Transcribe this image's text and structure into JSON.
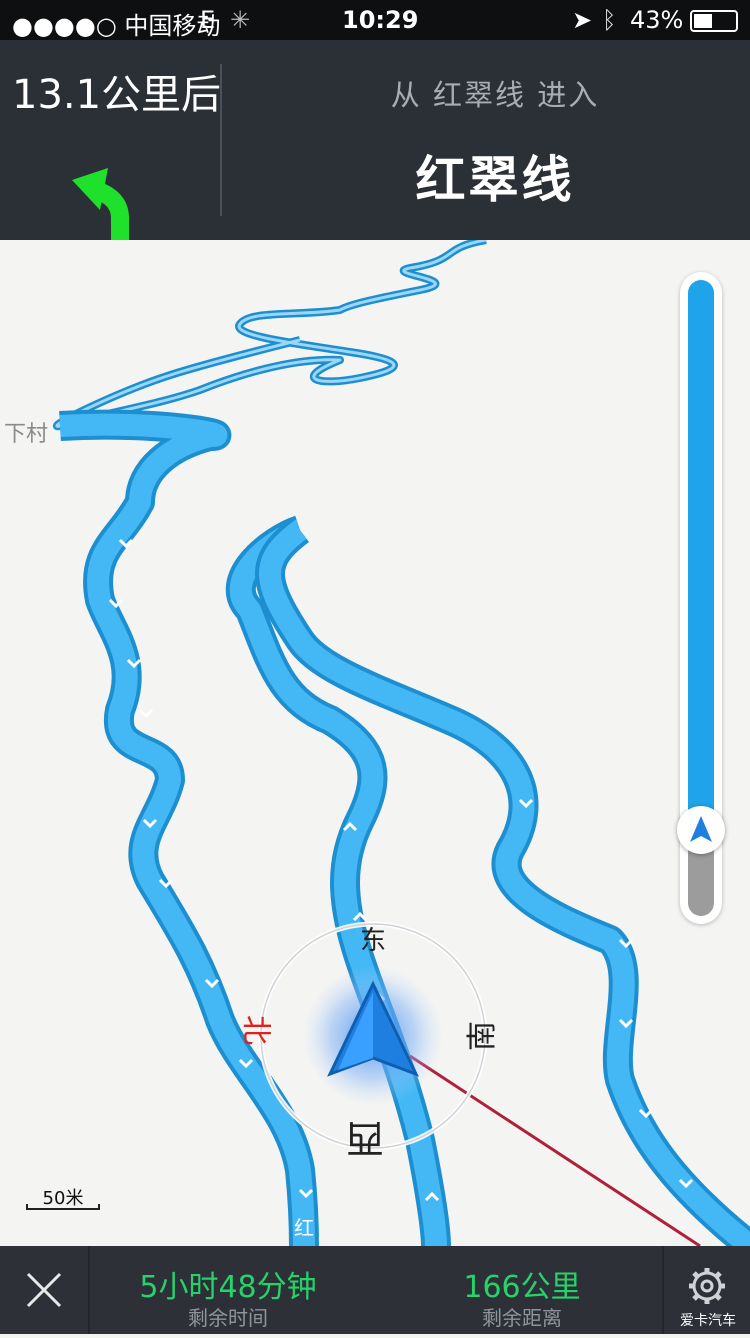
{
  "status_bar": {
    "carrier": "●●●●○ 中国移动",
    "network": "E",
    "time": "10:29",
    "battery_percent": "43%",
    "battery_level": 0.43
  },
  "header": {
    "distance": "13.1公里后",
    "enter_hint": "从 红翠线 进入",
    "road_name": "红翠线",
    "turn_icon": "turn-left-arrow",
    "turn_color": "#1fe02a"
  },
  "map": {
    "village_label": "下村",
    "road_label": "红",
    "compass": {
      "north": "北",
      "east": "东",
      "south": "南",
      "west": "西"
    },
    "scale": "50米",
    "zoom_level": 0.86,
    "route_color": "#2aa4e8"
  },
  "bottom_bar": {
    "time_value": "5小时48分钟",
    "time_caption": "剩余时间",
    "distance_value": "166公里",
    "distance_caption": "剩余距离",
    "settings_caption": "爱卡汽车",
    "accent_color": "#26d36a"
  }
}
